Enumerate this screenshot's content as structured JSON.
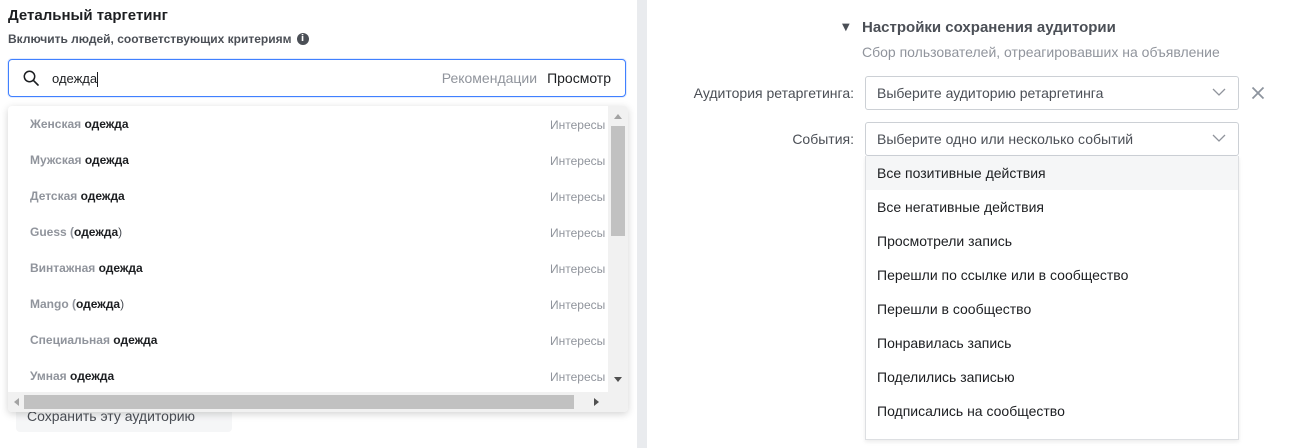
{
  "left": {
    "title": "Детальный таргетинг",
    "subtitle": "Включить людей, соответствующих критериям",
    "info_glyph": "i",
    "search": {
      "value": "одежда",
      "recommendations": "Рекомендации",
      "browse": "Просмотр"
    },
    "suggestions": [
      {
        "pre": "Женская ",
        "hl": "одежда",
        "post": "",
        "type": "Интересы"
      },
      {
        "pre": "Мужская ",
        "hl": "одежда",
        "post": "",
        "type": "Интересы"
      },
      {
        "pre": "Детская ",
        "hl": "одежда",
        "post": "",
        "type": "Интересы"
      },
      {
        "pre": "Guess (",
        "hl": "одежда",
        "post": ")",
        "type": "Интересы"
      },
      {
        "pre": "Винтажная ",
        "hl": "одежда",
        "post": "",
        "type": "Интересы"
      },
      {
        "pre": "Mango (",
        "hl": "одежда",
        "post": ")",
        "type": "Интересы"
      },
      {
        "pre": "Специальная ",
        "hl": "одежда",
        "post": "",
        "type": "Интересы"
      },
      {
        "pre": "Умная ",
        "hl": "одежда",
        "post": "",
        "type": "Интересы"
      }
    ],
    "save_button": "Сохранить эту аудиторию"
  },
  "right": {
    "section_title": "Настройки сохранения аудитории",
    "section_subtitle": "Сбор пользователей, отреагировавших на объявление",
    "retargeting_label": "Аудитория ретаргетинга:",
    "retargeting_placeholder": "Выберите аудиторию ретаргетинга",
    "events_label": "События:",
    "events_placeholder": "Выберите одно или несколько событий",
    "events": [
      "Все позитивные действия",
      "Все негативные действия",
      "Просмотрели запись",
      "Перешли по ссылке или в сообщество",
      "Перешли в сообщество",
      "Понравилась запись",
      "Поделились записью",
      "Подписались на сообщество"
    ]
  },
  "colors": {
    "accent": "#4080ff",
    "text": "#1c1e21",
    "muted": "#90949c",
    "divider": "#e9ebee"
  }
}
